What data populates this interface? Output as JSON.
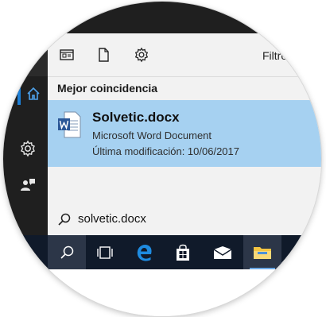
{
  "toolbar": {
    "icons": [
      "apps-icon",
      "document-icon",
      "settings-icon"
    ],
    "filter_label": "Filtro"
  },
  "sidebar": {
    "icons": [
      "home-icon",
      "settings-icon",
      "feedback-icon"
    ]
  },
  "results": {
    "section_title": "Mejor coincidencia",
    "best_match": {
      "title": "Solvetic.docx",
      "type": "Microsoft Word Document",
      "modified": "Última modificación: 10/06/2017"
    }
  },
  "search": {
    "query": "solvetic.docx"
  },
  "taskbar": {
    "items": [
      "search-icon",
      "task-view-icon",
      "edge-icon",
      "store-icon",
      "mail-icon",
      "file-explorer-icon"
    ]
  },
  "colors": {
    "highlight": "#a6d1f1",
    "accent": "#1d7fd6",
    "taskbar": "#101a2a"
  }
}
